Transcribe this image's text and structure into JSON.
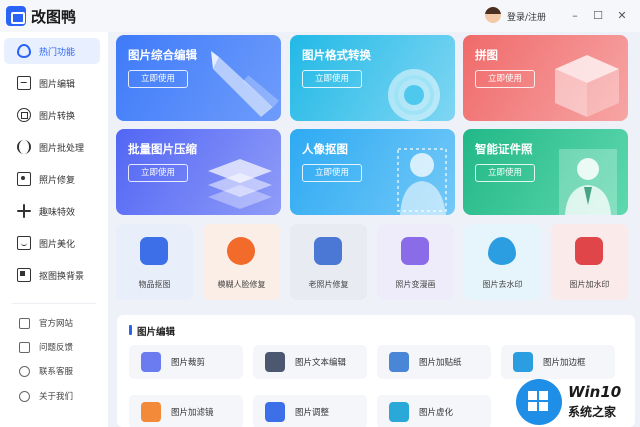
{
  "app": {
    "title": "改图鸭",
    "login": "登录/注册"
  },
  "window": {
    "minimize": "–",
    "maximize": "☐",
    "close": "✕"
  },
  "sidebar": {
    "items": [
      {
        "label": "热门功能",
        "icon": "flame-icon",
        "active": true
      },
      {
        "label": "图片编辑",
        "icon": "image-edit-icon",
        "active": false
      },
      {
        "label": "图片转换",
        "icon": "convert-icon",
        "active": false
      },
      {
        "label": "图片批处理",
        "icon": "batch-icon",
        "active": false
      },
      {
        "label": "照片修复",
        "icon": "photo-repair-icon",
        "active": false
      },
      {
        "label": "趣味特效",
        "icon": "sparkle-icon",
        "active": false
      },
      {
        "label": "图片美化",
        "icon": "beautify-icon",
        "active": false
      },
      {
        "label": "抠图换背景",
        "icon": "background-icon",
        "active": false
      }
    ],
    "links": [
      {
        "label": "官方网站",
        "icon": "website-icon"
      },
      {
        "label": "问题反馈",
        "icon": "feedback-icon"
      },
      {
        "label": "联系客服",
        "icon": "support-icon"
      },
      {
        "label": "关于我们",
        "icon": "info-icon"
      }
    ]
  },
  "cards": [
    {
      "title": "图片综合编辑",
      "button": "立即使用",
      "color": "#3f7bf9"
    },
    {
      "title": "图片格式转换",
      "button": "立即使用",
      "color": "#22b9e6"
    },
    {
      "title": "拼图",
      "button": "立即使用",
      "color": "#f06a6a"
    },
    {
      "title": "批量图片压缩",
      "button": "立即使用",
      "color": "#5266f4"
    },
    {
      "title": "人像抠图",
      "button": "立即使用",
      "color": "#2eaaf3"
    },
    {
      "title": "智能证件照",
      "button": "立即使用",
      "color": "#22b887"
    }
  ],
  "tools": [
    {
      "label": "物品抠图",
      "bg": "#e9eefb",
      "accent": "#3c6fe8",
      "icon": "cube-icon"
    },
    {
      "label": "模糊人脸修复",
      "bg": "#fbeee6",
      "accent": "#f26b2b",
      "icon": "face-icon"
    },
    {
      "label": "老照片修复",
      "bg": "#e8ebf2",
      "accent": "#4a78d4",
      "icon": "photo-icon"
    },
    {
      "label": "照片变漫画",
      "bg": "#eeecfb",
      "accent": "#8a6ce8",
      "icon": "star-icon"
    },
    {
      "label": "图片去水印",
      "bg": "#e6f4fb",
      "accent": "#2a9ee0",
      "icon": "drop-icon"
    },
    {
      "label": "图片加水印",
      "bg": "#fbeaea",
      "accent": "#e0454a",
      "icon": "seal-icon"
    }
  ],
  "panel": {
    "title": "图片编辑",
    "features": [
      {
        "label": "图片裁剪",
        "color": "#6b7cf0"
      },
      {
        "label": "图片文本编辑",
        "color": "#4b5870"
      },
      {
        "label": "图片加贴纸",
        "color": "#4a86d8"
      },
      {
        "label": "图片加边框",
        "color": "#2a9ee0"
      },
      {
        "label": "图片加滤镜",
        "color": "#f28a3a"
      },
      {
        "label": "图片调整",
        "color": "#3c6fe8"
      },
      {
        "label": "图片虚化",
        "color": "#2aa9d8"
      }
    ]
  },
  "watermark": {
    "line1": "Win10",
    "line2": "系统之家"
  }
}
